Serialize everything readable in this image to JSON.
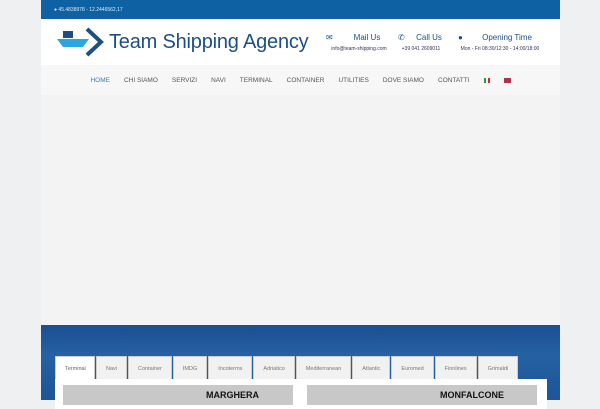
{
  "topbar": {
    "coords": "45.4838978 - 12.2446562,17"
  },
  "header": {
    "logo": "Team Shipping Agency",
    "mail": {
      "title": "Mail Us",
      "sub": "info@team-shipping.com"
    },
    "call": {
      "title": "Call Us",
      "sub": "+39 041 2609011"
    },
    "hours": {
      "title": "Opening Time",
      "sub": "Mon - Fri 08:30/12:30 - 14:00/18:00"
    }
  },
  "nav": [
    "HOME",
    "CHI SIAMO",
    "SERVIZI",
    "NAVI",
    "TERMINAL",
    "CONTAINER",
    "UTILITIES",
    "DOVE SIAMO",
    "CONTATTI"
  ],
  "tabs": [
    "Terminal",
    "Navi",
    "Container",
    "IMDG",
    "Incoterms",
    "Adriatico",
    "Mediterranean",
    "Atlantic",
    "Euromed",
    "Finnlines",
    "Grimaldi"
  ],
  "maps": [
    "MARGHERA",
    "MONFALCONE"
  ],
  "colors": {
    "brand": "#0e62a3",
    "logo": "#1b4f85",
    "accent": "#29a8e0"
  }
}
